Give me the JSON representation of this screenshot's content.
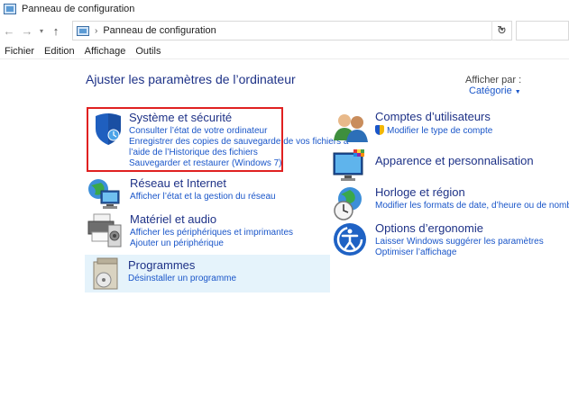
{
  "window": {
    "title": "Panneau de configuration"
  },
  "address": {
    "path": "Panneau de configuration",
    "separator": "›"
  },
  "nav": {
    "back": "←",
    "forward": "→",
    "up": "↑",
    "dropdown": "▾",
    "refresh": "↻"
  },
  "menu": [
    {
      "label": "Fichier"
    },
    {
      "label": "Edition"
    },
    {
      "label": "Affichage"
    },
    {
      "label": "Outils"
    }
  ],
  "main": {
    "heading": "Ajuster les paramètres de l’ordinateur",
    "view_by_label": "Afficher par :",
    "view_by_value": "Catégorie",
    "caret": "▼"
  },
  "categories": {
    "system": {
      "title": "Système et sécurité",
      "links": [
        "Consulter l’état de votre ordinateur",
        "Enregistrer des copies de sauvegarde de vos fichiers à",
        "l’aide de l’Historique des fichiers",
        "Sauvegarder et restaurer (Windows 7)"
      ]
    },
    "network": {
      "title": "Réseau et Internet",
      "links": [
        "Afficher l’état et la gestion du réseau"
      ]
    },
    "hardware": {
      "title": "Matériel et audio",
      "links": [
        "Afficher les périphériques et imprimantes",
        "Ajouter un périphérique"
      ]
    },
    "programs": {
      "title": "Programmes",
      "links": [
        "Désinstaller un programme"
      ]
    },
    "users": {
      "title": "Comptes d’utilisateurs",
      "links": [
        "Modifier le type de compte"
      ]
    },
    "appearance": {
      "title": "Apparence et personnalisation",
      "links": []
    },
    "clock": {
      "title": "Horloge et région",
      "links": [
        "Modifier les formats de date, d’heure ou de nombre"
      ]
    },
    "ease": {
      "title": "Options d’ergonomie",
      "links": [
        "Laisser Windows suggérer les paramètres",
        "Optimiser l’affichage"
      ]
    }
  },
  "colors": {
    "heading": "#1e3287",
    "link": "#1a56c9",
    "highlight_border": "#e02020",
    "selected_bg": "#e5f3fb"
  }
}
